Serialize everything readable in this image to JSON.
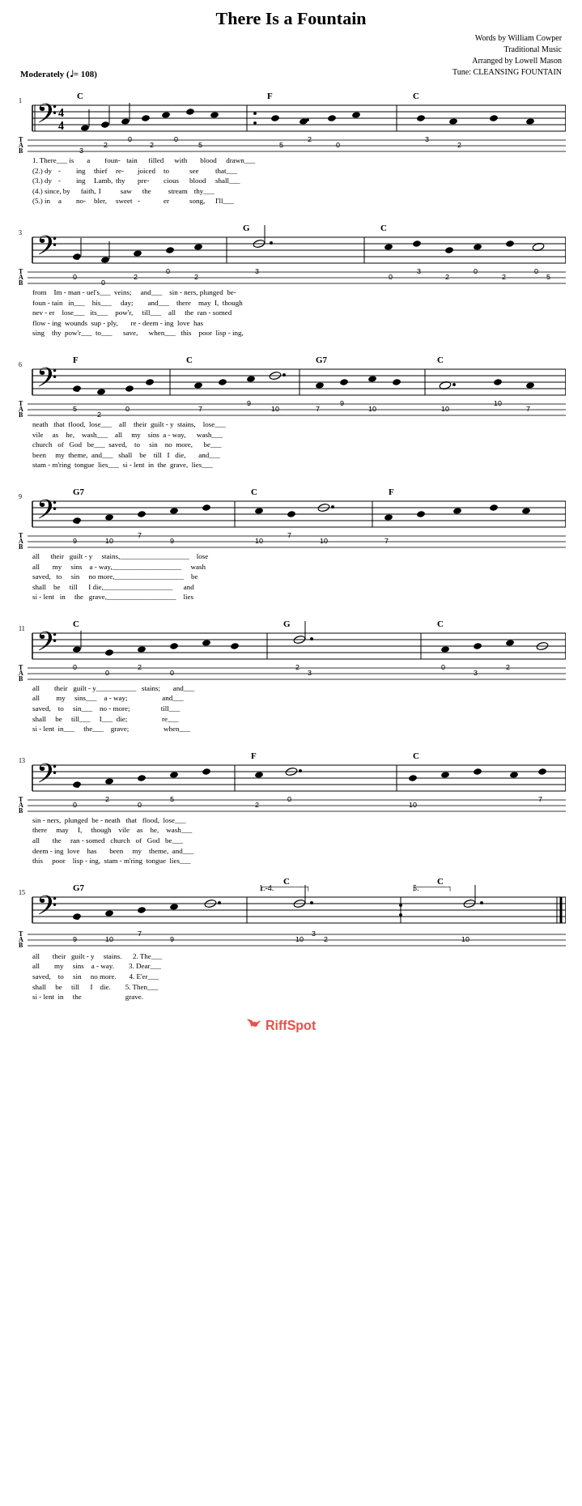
{
  "page": {
    "title": "There Is a Fountain",
    "credits": {
      "words": "Words by William Cowper",
      "music": "Traditional Music",
      "arranged": "Arranged by Lowell Mason",
      "tune": "Tune: CLEANSING FOUNTAIN"
    },
    "tempo": "Moderately (♩= 108)",
    "time_signature": "4/4",
    "clef": "bass"
  },
  "systems": [
    {
      "number": "1",
      "chords": [
        "C",
        "F",
        "C"
      ],
      "lyrics": [
        "1. There___      is        a      foun  -  tain    filled     with    blood    drawn___",
        "(2.)  dy   -   ing        thief   re   -  joiced    to       see      that___",
        "(3.)  dy   -   ing       Lamb,    thy    pre  -  cious    blood     shall___",
        "(4.)  since,    by       faith,     I      saw    the    stream     thy___",
        "(5.)  in         a       no  -  bler,   sweet   -   er     song,     I'll___"
      ],
      "tab": [
        "3",
        "2",
        "0",
        "2",
        "0",
        "5",
        "5",
        "2",
        "0",
        "3",
        "2"
      ]
    },
    {
      "number": "3",
      "chords": [
        "G",
        "C"
      ],
      "lyrics": [
        "from     Im  -  man  -  uel's___   veins;    and___    sin  -  ners, plunged  be  -",
        "foun  -  tain    in___    his___    day;     and___    there    may   I,  though",
        "nev  -   er      lose___   its___   pow'r,   till___    all     the   ran - somed",
        "flow  -  ing    wounds    sup  -   ply,      re   -   deem  -  ing   love   has",
        "sing     thy    pow'r___   to___    save,    when___   this    poor  lisp - ing,"
      ],
      "tab": [
        "0",
        "0",
        "2",
        "0",
        "2",
        "3",
        "0",
        "3",
        "2",
        "0",
        "2",
        "0",
        "5"
      ]
    },
    {
      "number": "6",
      "chords": [
        "F",
        "C",
        "G7",
        "C"
      ],
      "lyrics": [
        "neath    that   flood,   lose___    all     their   guilt  -  y    stains,    lose___",
        "vile      as    he,     wash___    all      my     sins    a  -  way,         wash___",
        "church    of    God    be___    saved,     to     sin     no    more,          be___",
        "been      my   theme,  and___   shall     be     till     I     die,           and___",
        "stam - m'ring  tongue   lies___    si   -  lent    in     the    grave,        lies___"
      ],
      "tab": [
        "5",
        "2",
        "0",
        "7",
        "9",
        "10",
        "7",
        "9",
        "10",
        "10",
        "7"
      ]
    },
    {
      "number": "9",
      "chords": [
        "G7",
        "C",
        "F"
      ],
      "lyrics": [
        "all      their    guilt   -   y       stains,___________________    lose",
        "all       my      sins     a  -  way,___________________            wash",
        "saved,    to      sin      no     more,___________________           be",
        "shall     be      till      I       die,___________________           and",
        "si    -  lent     in       the      grave,___________________         lies"
      ],
      "tab": [
        "9",
        "10",
        "7",
        "9",
        "10",
        "7",
        "10",
        "7"
      ]
    },
    {
      "number": "11",
      "chords": [
        "C",
        "G",
        "C"
      ],
      "lyrics": [
        "all        their    guilt   -   y___________     stains;       and___",
        "all         my      sins___      a    -   way;                  and___",
        "saved,      to      sin___       no    -  more;                 till___",
        "shall       be      till___       I___  -  die;                 re___",
        "si    -    lent     in___         the___    grave;              when___"
      ],
      "tab": [
        "0",
        "0",
        "2",
        "0",
        "2",
        "3",
        "0",
        "3",
        "2"
      ]
    },
    {
      "number": "13",
      "chords": [
        "F",
        "C"
      ],
      "lyrics": [
        "sin    -   ners,   plunged    be  -   neath    that    flood,    lose___",
        "there      may      I,       though   vile      as      he,      wash___",
        "all        the     ran   -  somed    church     of     God      be___",
        "deem   -   ing      love      has     been       my    theme,    and___",
        "this      poor     lisp  -   ing,    stam   - m'ring  tongue    lies___"
      ],
      "tab": [
        "0",
        "2",
        "0",
        "5",
        "2",
        "0",
        "10",
        "7"
      ]
    },
    {
      "number": "15",
      "chords": [
        "G7",
        "C (1-4)",
        "C (5)"
      ],
      "lyrics": [
        "all        their    guilt   -   y       stains.      2. The___",
        "all         my      sins      a  -  way.             3. Dear___",
        "saved,      to      sin       no      more.          4. E'er___",
        "shall       be      till       I        die.         5. Then___",
        "si    -    lent     in        the                         grave."
      ],
      "tab": [
        "9",
        "10",
        "7",
        "9",
        "10",
        "3",
        "2",
        "10"
      ]
    }
  ],
  "footer": {
    "brand": "RiffSpot",
    "icon": "♪"
  }
}
